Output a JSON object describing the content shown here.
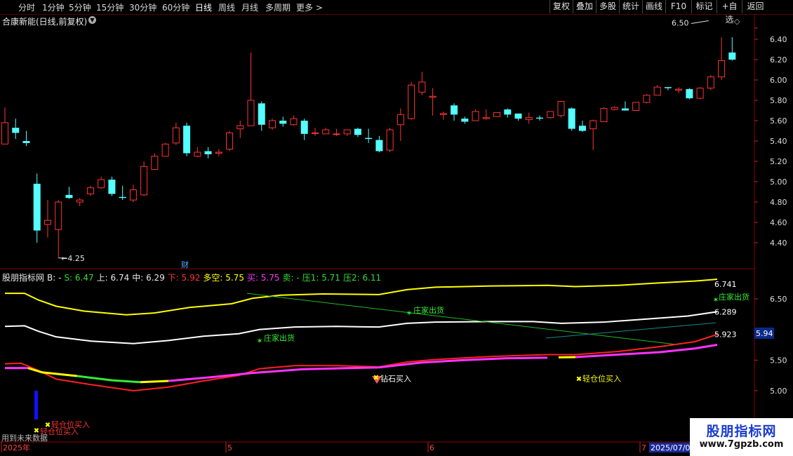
{
  "toolbar": {
    "periods": [
      "分时",
      "1分钟",
      "5分钟",
      "15分钟",
      "30分钟",
      "60分钟",
      "日线",
      "周线",
      "月线",
      "多周期",
      "更多"
    ],
    "active_period": "日线",
    "more_chevron": ">",
    "buttons": [
      "复权",
      "叠加",
      "多股",
      "统计",
      "画线",
      "F10",
      "标记",
      "+自选",
      "返回"
    ]
  },
  "stock_title": "合康新能(日线,前复权)",
  "price_axis": [
    "6.40",
    "6.20",
    "6.00",
    "5.80",
    "5.60",
    "5.40",
    "5.20",
    "5.00",
    "4.80",
    "4.60",
    "4.40"
  ],
  "price_annotations": {
    "high": "6.50",
    "low": "4.25",
    "badge": "财"
  },
  "indicator_title": [
    {
      "text": "股朋指标网",
      "color": "#e8e8e8"
    },
    {
      "text": "B: -",
      "color": "#e8e8e8"
    },
    {
      "text": "S: 6.47",
      "color": "#33dd33"
    },
    {
      "text": "上: 6.74",
      "color": "#e8e8e8"
    },
    {
      "text": "中: 6.29",
      "color": "#e8e8e8"
    },
    {
      "text": "下: 5.92",
      "color": "#ff3333"
    },
    {
      "text": "多空: 5.75",
      "color": "#ffff00"
    },
    {
      "text": "买: 5.75",
      "color": "#ff33ff"
    },
    {
      "text": "卖: -",
      "color": "#33dd33"
    },
    {
      "text": "压1: 5.71",
      "color": "#33dd33"
    },
    {
      "text": "压2: 6.11",
      "color": "#33dd33"
    }
  ],
  "indicator_axis": [
    "6.50",
    "5.94",
    "5.50",
    "5.00",
    "4.50"
  ],
  "indicator_current": "5.94",
  "indicator_values": {
    "upper": "6.741",
    "middle": "6.289",
    "lower": "5.923"
  },
  "signals": {
    "sell_1": "庄家出货",
    "sell_2": "庄家出货",
    "sell_3": "庄家出货",
    "diamond": "钻石买入",
    "buy_1": "轻仓位买入",
    "buy_2": "轻仓位买入",
    "light_buy": "轻仓位买入"
  },
  "bottom_note": "用到未来数据",
  "date_axis": [
    "2025年",
    "5",
    "6",
    "7",
    "2025/07/09"
  ],
  "watermark": {
    "name": "股朋指标网",
    "url": "www.7gpzb.com"
  },
  "colors": {
    "up": "#ff3333",
    "down": "#54ffff",
    "upper_line": "#ffff00",
    "mid_line": "#ffffff",
    "lower_line": "#ff2020",
    "buy_line": "#ff33ff"
  },
  "chart_data": {
    "type": "candlestick",
    "ylim": [
      4.3,
      6.5
    ],
    "candles": [
      {
        "o": 5.37,
        "h": 5.73,
        "l": 5.37,
        "c": 5.58
      },
      {
        "o": 5.53,
        "h": 5.62,
        "l": 5.42,
        "c": 5.48
      },
      {
        "o": 5.4,
        "h": 5.5,
        "l": 5.35,
        "c": 5.38
      },
      {
        "o": 4.98,
        "h": 5.08,
        "l": 4.4,
        "c": 4.52
      },
      {
        "o": 4.58,
        "h": 4.82,
        "l": 4.45,
        "c": 4.62
      },
      {
        "o": 4.53,
        "h": 4.82,
        "l": 4.25,
        "c": 4.8
      },
      {
        "o": 4.87,
        "h": 4.95,
        "l": 4.83,
        "c": 4.84
      },
      {
        "o": 4.8,
        "h": 4.84,
        "l": 4.76,
        "c": 4.82
      },
      {
        "o": 4.88,
        "h": 4.96,
        "l": 4.86,
        "c": 4.94
      },
      {
        "o": 4.94,
        "h": 5.05,
        "l": 4.93,
        "c": 5.02
      },
      {
        "o": 5.02,
        "h": 5.05,
        "l": 4.86,
        "c": 4.88
      },
      {
        "o": 4.85,
        "h": 4.96,
        "l": 4.82,
        "c": 4.84
      },
      {
        "o": 4.82,
        "h": 4.97,
        "l": 4.8,
        "c": 4.92
      },
      {
        "o": 4.87,
        "h": 5.2,
        "l": 4.86,
        "c": 5.15
      },
      {
        "o": 5.12,
        "h": 5.28,
        "l": 5.12,
        "c": 5.25
      },
      {
        "o": 5.25,
        "h": 5.38,
        "l": 5.25,
        "c": 5.37
      },
      {
        "o": 5.38,
        "h": 5.58,
        "l": 5.36,
        "c": 5.53
      },
      {
        "o": 5.55,
        "h": 5.58,
        "l": 5.25,
        "c": 5.28
      },
      {
        "o": 5.25,
        "h": 5.34,
        "l": 5.24,
        "c": 5.29
      },
      {
        "o": 5.3,
        "h": 5.34,
        "l": 5.23,
        "c": 5.27
      },
      {
        "o": 5.28,
        "h": 5.32,
        "l": 5.25,
        "c": 5.29
      },
      {
        "o": 5.32,
        "h": 5.5,
        "l": 5.3,
        "c": 5.48
      },
      {
        "o": 5.52,
        "h": 5.6,
        "l": 5.43,
        "c": 5.55
      },
      {
        "o": 5.55,
        "h": 6.27,
        "l": 5.55,
        "c": 5.8
      },
      {
        "o": 5.77,
        "h": 5.79,
        "l": 5.5,
        "c": 5.56
      },
      {
        "o": 5.53,
        "h": 5.62,
        "l": 5.51,
        "c": 5.6
      },
      {
        "o": 5.6,
        "h": 5.64,
        "l": 5.54,
        "c": 5.57
      },
      {
        "o": 5.56,
        "h": 5.65,
        "l": 5.55,
        "c": 5.62
      },
      {
        "o": 5.6,
        "h": 5.62,
        "l": 5.41,
        "c": 5.47
      },
      {
        "o": 5.48,
        "h": 5.53,
        "l": 5.45,
        "c": 5.48
      },
      {
        "o": 5.47,
        "h": 5.53,
        "l": 5.47,
        "c": 5.51
      },
      {
        "o": 5.47,
        "h": 5.52,
        "l": 5.45,
        "c": 5.47
      },
      {
        "o": 5.47,
        "h": 5.51,
        "l": 5.45,
        "c": 5.51
      },
      {
        "o": 5.52,
        "h": 5.53,
        "l": 5.44,
        "c": 5.46
      },
      {
        "o": 5.43,
        "h": 5.52,
        "l": 5.38,
        "c": 5.42
      },
      {
        "o": 5.41,
        "h": 5.45,
        "l": 5.29,
        "c": 5.3
      },
      {
        "o": 5.31,
        "h": 5.53,
        "l": 5.29,
        "c": 5.51
      },
      {
        "o": 5.56,
        "h": 5.72,
        "l": 5.4,
        "c": 5.66
      },
      {
        "o": 5.62,
        "h": 5.98,
        "l": 5.61,
        "c": 5.95
      },
      {
        "o": 5.88,
        "h": 6.08,
        "l": 5.85,
        "c": 5.98
      },
      {
        "o": 5.83,
        "h": 5.92,
        "l": 5.65,
        "c": 5.84
      },
      {
        "o": 5.66,
        "h": 5.69,
        "l": 5.61,
        "c": 5.67
      },
      {
        "o": 5.75,
        "h": 5.77,
        "l": 5.6,
        "c": 5.66
      },
      {
        "o": 5.62,
        "h": 5.64,
        "l": 5.57,
        "c": 5.59
      },
      {
        "o": 5.6,
        "h": 5.71,
        "l": 5.6,
        "c": 5.69
      },
      {
        "o": 5.62,
        "h": 5.71,
        "l": 5.61,
        "c": 5.63
      },
      {
        "o": 5.64,
        "h": 5.68,
        "l": 5.64,
        "c": 5.68
      },
      {
        "o": 5.71,
        "h": 5.72,
        "l": 5.63,
        "c": 5.66
      },
      {
        "o": 5.67,
        "h": 5.67,
        "l": 5.6,
        "c": 5.62
      },
      {
        "o": 5.61,
        "h": 5.68,
        "l": 5.57,
        "c": 5.63
      },
      {
        "o": 5.63,
        "h": 5.65,
        "l": 5.6,
        "c": 5.62
      },
      {
        "o": 5.63,
        "h": 5.69,
        "l": 5.62,
        "c": 5.69
      },
      {
        "o": 5.65,
        "h": 5.79,
        "l": 5.63,
        "c": 5.79
      },
      {
        "o": 5.72,
        "h": 5.73,
        "l": 5.5,
        "c": 5.52
      },
      {
        "o": 5.55,
        "h": 5.6,
        "l": 5.49,
        "c": 5.5
      },
      {
        "o": 5.52,
        "h": 5.61,
        "l": 5.31,
        "c": 5.6
      },
      {
        "o": 5.59,
        "h": 5.73,
        "l": 5.59,
        "c": 5.72
      },
      {
        "o": 5.71,
        "h": 5.74,
        "l": 5.7,
        "c": 5.73
      },
      {
        "o": 5.72,
        "h": 5.79,
        "l": 5.7,
        "c": 5.7
      },
      {
        "o": 5.7,
        "h": 5.78,
        "l": 5.7,
        "c": 5.78
      },
      {
        "o": 5.78,
        "h": 5.86,
        "l": 5.77,
        "c": 5.85
      },
      {
        "o": 5.85,
        "h": 5.95,
        "l": 5.85,
        "c": 5.93
      },
      {
        "o": 5.93,
        "h": 5.93,
        "l": 5.9,
        "c": 5.92
      },
      {
        "o": 5.9,
        "h": 5.93,
        "l": 5.87,
        "c": 5.91
      },
      {
        "o": 5.91,
        "h": 5.92,
        "l": 5.81,
        "c": 5.82
      },
      {
        "o": 5.82,
        "h": 5.93,
        "l": 5.81,
        "c": 5.92
      },
      {
        "o": 5.92,
        "h": 6.05,
        "l": 5.9,
        "c": 6.03
      },
      {
        "o": 6.03,
        "h": 6.42,
        "l": 6.0,
        "c": 6.19
      },
      {
        "o": 6.27,
        "h": 6.42,
        "l": 6.19,
        "c": 6.2
      }
    ]
  }
}
